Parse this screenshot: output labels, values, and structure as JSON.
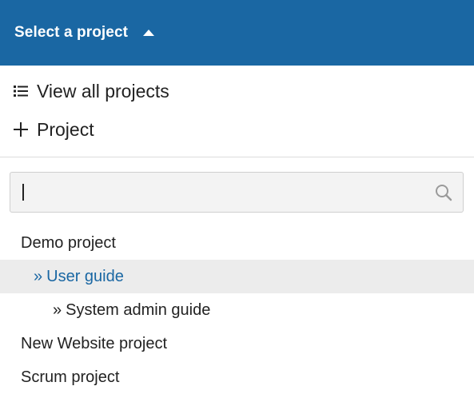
{
  "header": {
    "title": "Select a project",
    "caret_icon": "caret-up-icon",
    "background_color": "#1a67a3"
  },
  "actions": [
    {
      "label": "View all projects",
      "icon": "list-icon"
    },
    {
      "label": "Project",
      "icon": "plus-icon"
    }
  ],
  "search": {
    "value": "",
    "placeholder": "",
    "icon": "search-icon"
  },
  "projects": [
    {
      "label": "Demo project",
      "prefix": "",
      "level": 0,
      "selected": false
    },
    {
      "label": "User guide",
      "prefix": "»",
      "level": 1,
      "selected": true
    },
    {
      "label": "System admin guide",
      "prefix": "»",
      "level": 2,
      "selected": false
    },
    {
      "label": "New Website project",
      "prefix": "",
      "level": 0,
      "selected": false
    },
    {
      "label": "Scrum project",
      "prefix": "",
      "level": 0,
      "selected": false
    }
  ],
  "colors": {
    "accent": "#1a67a3",
    "selected_background": "#ececec"
  }
}
